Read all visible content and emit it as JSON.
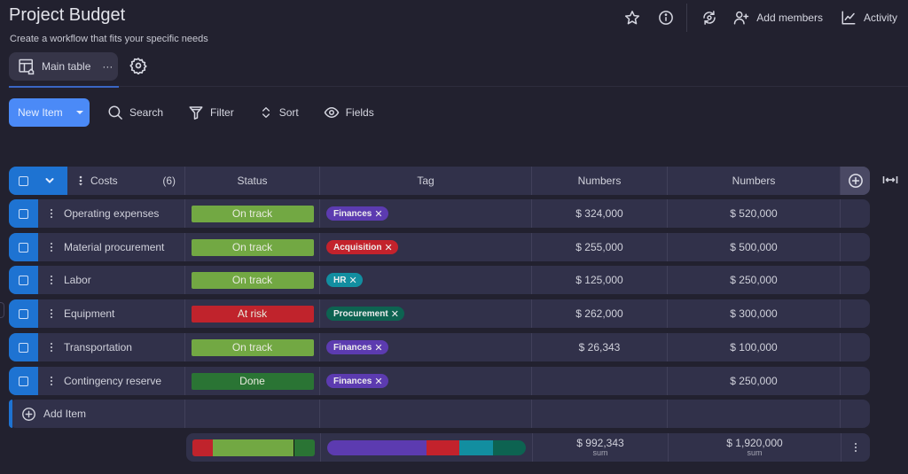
{
  "header": {
    "title": "Project Budget",
    "subtitle": "Create a workflow that fits your specific needs",
    "actions": {
      "favorite_icon": "star-icon",
      "info_icon": "info-icon",
      "sync_icon": "sync-icon",
      "add_members_label": "Add members",
      "activity_label": "Activity"
    }
  },
  "view": {
    "tab_label": "Main table",
    "tab_more": "···"
  },
  "toolbar": {
    "new_item_label": "New Item",
    "search_label": "Search",
    "filter_label": "Filter",
    "sort_label": "Sort",
    "fields_label": "Fields"
  },
  "table": {
    "group_name": "Costs",
    "group_count": "(6)",
    "columns": {
      "status": "Status",
      "tag": "Tag",
      "numbers1": "Numbers",
      "numbers2": "Numbers"
    },
    "rows": [
      {
        "name": "Operating expenses",
        "status": "On track",
        "status_color": "#72a843",
        "tag": "Finances",
        "tag_color": "#5c3bb0",
        "num1": "$ 324,000",
        "num2": "$ 520,000"
      },
      {
        "name": "Material procurement",
        "status": "On track",
        "status_color": "#72a843",
        "tag": "Acquisition",
        "tag_color": "#c3222c",
        "num1": "$ 255,000",
        "num2": "$ 500,000"
      },
      {
        "name": "Labor",
        "status": "On track",
        "status_color": "#72a843",
        "tag": "HR",
        "tag_color": "#128ea0",
        "num1": "$ 125,000",
        "num2": "$ 250,000"
      },
      {
        "name": "Equipment",
        "status": "At risk",
        "status_color": "#c0232c",
        "tag": "Procurement",
        "tag_color": "#0d6351",
        "num1": "$ 262,000",
        "num2": "$ 300,000"
      },
      {
        "name": "Transportation",
        "status": "On track",
        "status_color": "#72a843",
        "tag": "Finances",
        "tag_color": "#5c3bb0",
        "num1": "$ 26,343",
        "num2": "$ 100,000"
      },
      {
        "name": "Contingency reserve",
        "status": "Done",
        "status_color": "#2a7434",
        "tag": "Finances",
        "tag_color": "#5c3bb0",
        "num1": "",
        "num2": "$ 250,000"
      }
    ],
    "add_item_label": "Add Item",
    "summary": {
      "status_distribution": [
        {
          "label": "At risk",
          "fraction": 0.1667,
          "color": "#c0232c"
        },
        {
          "label": "On track",
          "fraction": 0.6667,
          "color": "#72a843"
        },
        {
          "label": "Done",
          "fraction": 0.1667,
          "color": "#2a7434"
        }
      ],
      "tag_distribution": [
        {
          "label": "Finances",
          "fraction": 0.5,
          "color": "#5c3bb0"
        },
        {
          "label": "Acquisition",
          "fraction": 0.1667,
          "color": "#c3222c"
        },
        {
          "label": "HR",
          "fraction": 0.1667,
          "color": "#128ea0"
        },
        {
          "label": "Procurement",
          "fraction": 0.1667,
          "color": "#0d6351"
        }
      ],
      "num1_sum": "$ 992,343",
      "num2_sum": "$ 1,920,000",
      "sum_label": "sum"
    }
  }
}
